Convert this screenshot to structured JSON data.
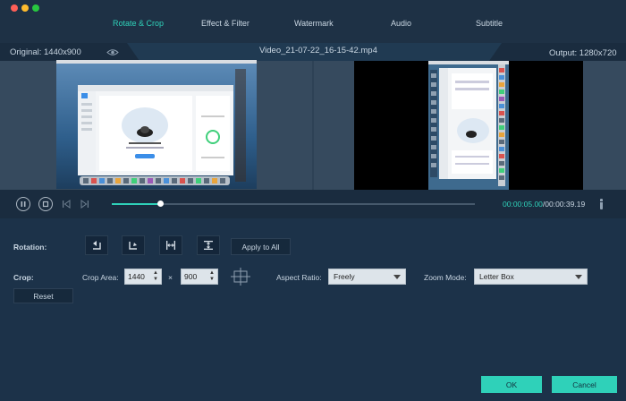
{
  "tabs": [
    {
      "label": "Rotate & Crop",
      "active": true
    },
    {
      "label": "Effect & Filter",
      "active": false
    },
    {
      "label": "Watermark",
      "active": false
    },
    {
      "label": "Audio",
      "active": false
    },
    {
      "label": "Subtitle",
      "active": false
    }
  ],
  "info": {
    "original": "Original: 1440x900",
    "filename": "Video_21-07-22_16-15-42.mp4",
    "output": "Output: 1280x720"
  },
  "playback": {
    "current_time": "00:00:05.00",
    "total_time": "/00:00:39.19",
    "progress": 0.133
  },
  "rotation": {
    "label": "Rotation:",
    "apply_all": "Apply to All"
  },
  "crop": {
    "label": "Crop:",
    "area_label": "Crop Area:",
    "width": "1440",
    "times": "×",
    "height": "900",
    "aspect_label": "Aspect Ratio:",
    "aspect_value": "Freely",
    "zoom_label": "Zoom Mode:",
    "zoom_value": "Letter Box",
    "reset": "Reset"
  },
  "footer": {
    "ok": "OK",
    "cancel": "Cancel"
  },
  "colors": {
    "accent": "#2fd1b9",
    "background": "#1c2f43"
  }
}
